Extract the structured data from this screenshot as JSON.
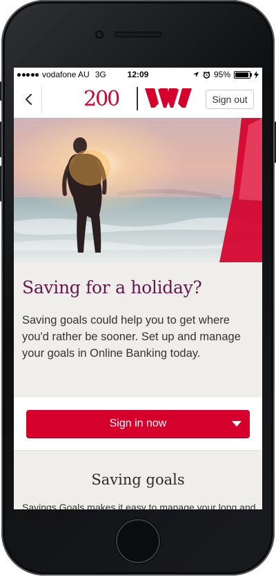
{
  "status_bar": {
    "carrier": "vodafone AU",
    "network": "3G",
    "time": "12:09",
    "battery_percent": "95%",
    "battery_level": 0.95
  },
  "nav": {
    "back_icon": "chevron-left-icon",
    "logo_200": "200",
    "brand_logo_icon": "westpac-w-logo-icon",
    "sign_out_label": "Sign out"
  },
  "hero": {
    "image_icon": "woman-in-sea-photo"
  },
  "promo": {
    "headline": "Saving for a holiday?",
    "body": "Saving goals could help you to get where you'd rather be sooner. Set up and manage your goals in Online Banking today."
  },
  "cta": {
    "sign_in_label": "Sign in now",
    "dropdown_icon": "caret-down-icon"
  },
  "section": {
    "title": "Saving goals",
    "text": "Savings Goals makes it easy to manage your long and"
  },
  "colors": {
    "brand_red": "#d5002b",
    "headline_purple": "#621a4b",
    "background": "#f0eeeb"
  }
}
